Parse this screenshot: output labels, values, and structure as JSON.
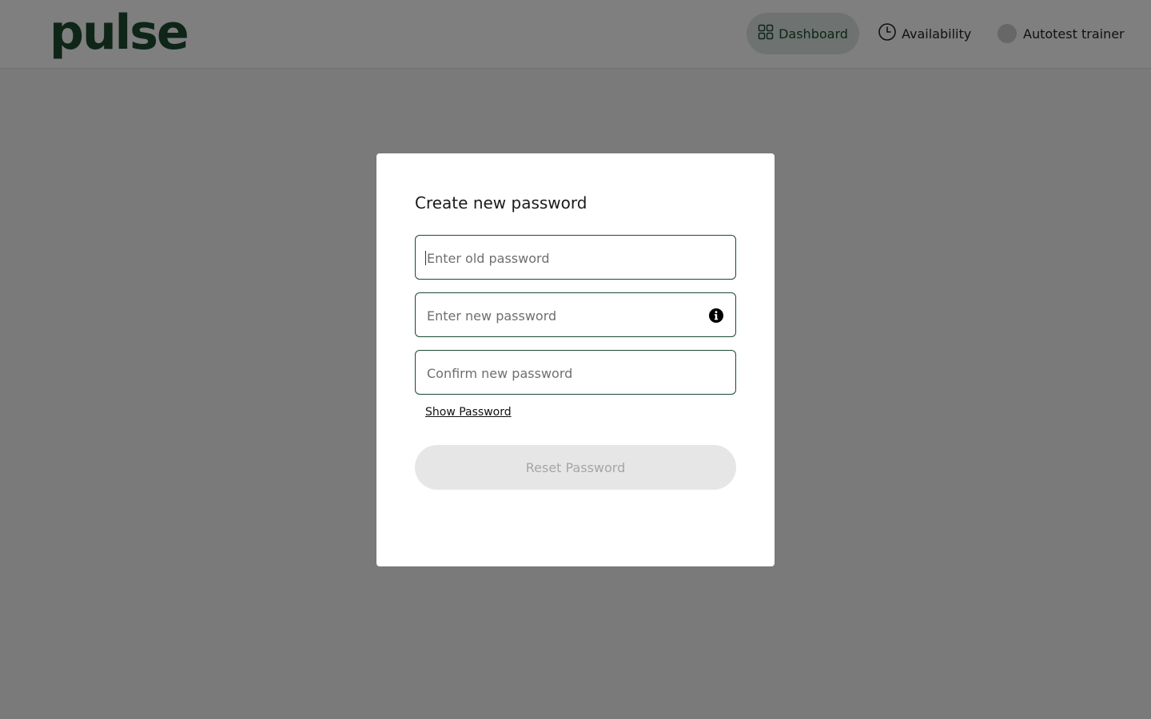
{
  "header": {
    "logo": "pulse",
    "nav": {
      "dashboard": {
        "label": "Dashboard",
        "icon": "grid-icon"
      },
      "availability": {
        "label": "Availability",
        "icon": "clock-icon"
      },
      "user": {
        "label": "Autotest trainer",
        "icon": "avatar"
      }
    }
  },
  "modal": {
    "title": "Create new password",
    "fields": {
      "old_password": {
        "value": "",
        "placeholder": "Enter old password"
      },
      "new_password": {
        "value": "",
        "placeholder": "Enter new password",
        "icon": "info-icon"
      },
      "confirm_password": {
        "value": "",
        "placeholder": "Confirm new password"
      }
    },
    "show_password_label": "Show Password",
    "reset_button_label": "Reset Password",
    "reset_button_disabled": true
  },
  "colors": {
    "brand": "#1c4a31",
    "active_nav_bg": "#dde4e0",
    "overlay": "rgba(0,0,0,0.5)",
    "disabled_button_bg": "#e6e6e6",
    "disabled_button_text": "#a6a6a6"
  }
}
